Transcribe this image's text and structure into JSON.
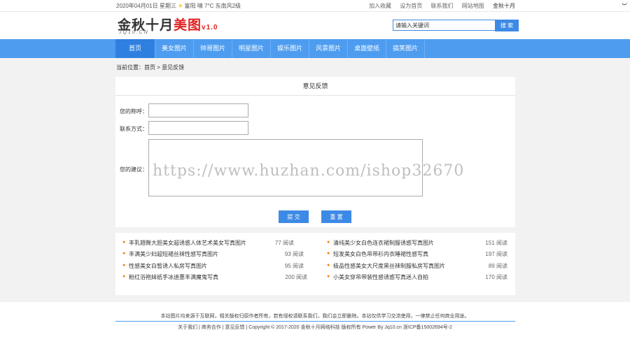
{
  "topbar": {
    "date": "2020年04月01日",
    "weekday": "星期三",
    "weather": "富阳 晴",
    "temp": "7°C",
    "wind": "东南风2级",
    "links": [
      "加入收藏",
      "设为首页",
      "联系我们",
      "网站地图"
    ],
    "last_link": "金秋十月"
  },
  "corner": "ب",
  "logo": {
    "main": "金秋十月",
    "accent": "美图",
    "version": "v1.0",
    "sub": "JQ10.CN"
  },
  "search": {
    "value": "请输入关键词",
    "button": "搜 索",
    "accent": "#3d8ae6"
  },
  "nav": {
    "color": "#4d9cf0",
    "items": [
      "首页",
      "美女图片",
      "帅哥图片",
      "明星图片",
      "娱乐图片",
      "风景图片",
      "桌面壁纸",
      "搞笑图片"
    ]
  },
  "breadcrumb": "当前位置：首页 > 意见反馈",
  "form": {
    "title": "意见反馈",
    "name_label": "您的称呼：",
    "contact_label": "联系方式：",
    "message_label": "您的建议：",
    "submit": "提 交",
    "reset": "重 置"
  },
  "watermark": "https://www.huzhan.com/ishop32670",
  "list": {
    "left": [
      {
        "title": "丰乳翘臀大胆美女超诱惑人体艺术美女写真图片",
        "count": "77 阅读"
      },
      {
        "title": "丰满美少妇超短裙丝袜性感写真图片",
        "count": "93 阅读"
      },
      {
        "title": "性感美女白皙诱人私房写真图片",
        "count": "95 阅读"
      },
      {
        "title": "粉红浴袍妹纸手冰迪惠丰满魔鬼写真",
        "count": "200 阅读"
      }
    ],
    "right": [
      {
        "title": "清纯美少女白色连衣裙制服诱惑写真图片",
        "count": "151 阅读"
      },
      {
        "title": "短发美女白色吊带衫内衣睡裙性感写真",
        "count": "197 阅读"
      },
      {
        "title": "极品性感美女大尺度黑丝袜制服私房写真图片",
        "count": "89 阅读"
      },
      {
        "title": "小美女穿吊带装性感诱惑写真迷人自拍",
        "count": "170 阅读"
      }
    ]
  },
  "footer": {
    "notice": "本站图片均来源于互联网，相关版权归原作者所有，若有侵权请联系我们，我们会立即删除。本站仅供学习交流使用，一律禁止任何商业用途。",
    "links": "关于我们 | 商务合作 | 意见反馈 | Copyright © 2017-2020 金秋十月网络科技 版权所有 Power By Jq10.cn 浙ICP备15002694号-2"
  }
}
